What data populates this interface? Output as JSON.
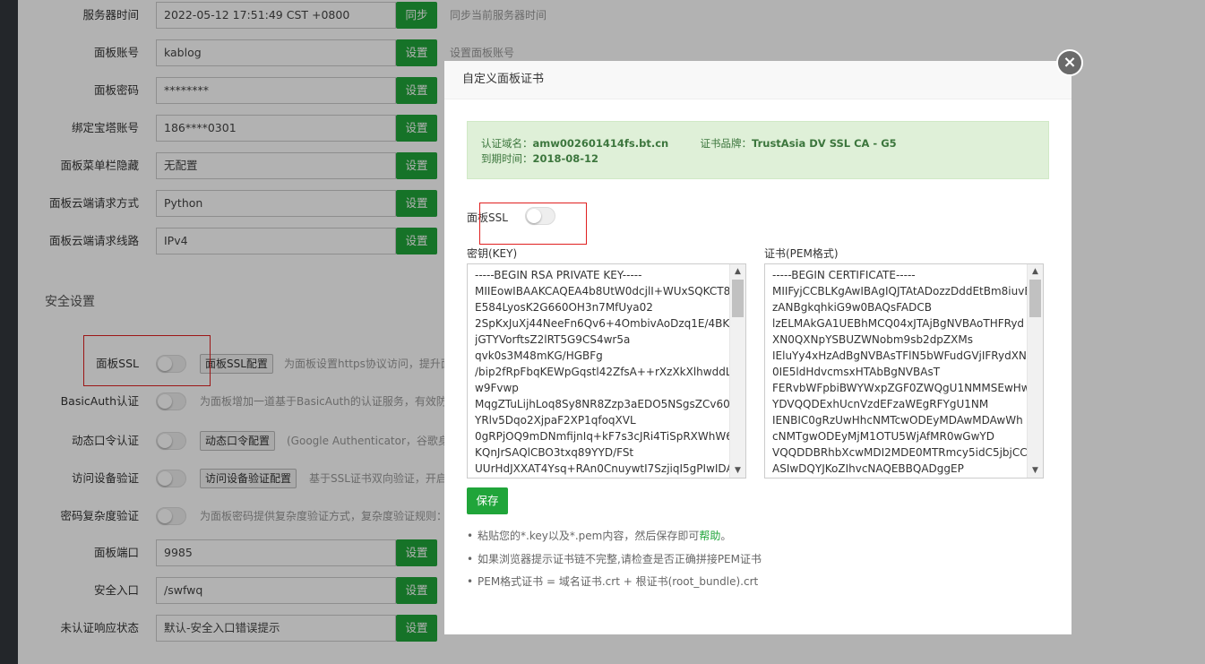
{
  "settings": {
    "rows": [
      {
        "label": "服务器时间",
        "value": "2022-05-12 17:51:49 CST +0800",
        "button": "同步",
        "hint": "同步当前服务器时间"
      },
      {
        "label": "面板账号",
        "value": "kablog",
        "button": "设置",
        "hint": "设置面板账号"
      },
      {
        "label": "面板密码",
        "value": "********",
        "button": "设置",
        "hint": ""
      },
      {
        "label": "绑定宝塔账号",
        "value": "186****0301",
        "button": "设置",
        "hint": ""
      },
      {
        "label": "面板菜单栏隐藏",
        "value": "无配置",
        "button": "设置",
        "hint": ""
      },
      {
        "label": "面板云端请求方式",
        "value": "Python",
        "button": "设置",
        "hint": ""
      },
      {
        "label": "面板云端请求线路",
        "value": "IPv4",
        "button": "设置",
        "hint": ""
      }
    ],
    "security_title": "安全设置",
    "toggles": [
      {
        "label": "面板SSL",
        "button": "面板SSL配置",
        "desc": "为面板设置https协议访问，提升面"
      },
      {
        "label": "BasicAuth认证",
        "button": "",
        "desc": "为面板增加一道基于BasicAuth的认证服务，有效防"
      },
      {
        "label": "动态口令认证",
        "button": "动态口令配置",
        "desc": "(Google Authenticator，谷歌身"
      },
      {
        "label": "访问设备验证",
        "button": "访问设备验证配置",
        "desc": "基于SSL证书双向验证，开启"
      },
      {
        "label": "密码复杂度验证",
        "button": "",
        "desc": "为面板密码提供复杂度验证方式，复杂度验证规则："
      }
    ],
    "rows2": [
      {
        "label": "面板端口",
        "value": "9985",
        "button": "设置"
      },
      {
        "label": "安全入口",
        "value": "/swfwq",
        "button": "设置"
      },
      {
        "label": "未认证响应状态",
        "value": "默认-安全入口错误提示",
        "button": "设置"
      }
    ]
  },
  "modal": {
    "title": "自定义面板证书",
    "close": "×",
    "domain_label": "认证域名：",
    "domain": "amw002601414fs.bt.cn",
    "brand_label": "证书品牌：",
    "brand": "TrustAsia DV SSL CA - G5",
    "expire_label": "到期时间：",
    "expire": "2018-08-12",
    "ssl_label": "面板SSL",
    "key_label": "密钥(KEY)",
    "cert_label": "证书(PEM格式)",
    "key_lines": [
      "-----BEGIN RSA PRIVATE KEY-----",
      "MIIEowIBAAKCAQEA4b8UtW0dcjlI+WUxSQKCT8",
      "E584LyosK2G660OH3n7MfUya02",
      "2SpKxJuXj44NeeFn6Qv6+4OmbivAoDzq1E/4BKE",
      "jGTYVorftsZ2lRT5G9CS4wr5a",
      "qvk0s3M48mKG/HGBFg",
      "/bip2fRpFbqKEWpGqstl42ZfsA++rXzXkXlhwddL",
      "w9Fvwp",
      "MqgZTuLijhLoq8Sy8NR8Zzp3aEDO5NSgsZCv60Z",
      "YRlv5Dqo2XjpaF2XP1qfoqXVL",
      "0gRPjOQ9mDNmfijnIq+kF7s3cJRi4TiSpRXWhW6",
      "KQnJrSAQlCBO3txq89YYD/FSt",
      "UUrHdJXXAT4Ysq+RAn0CnuywtI7SzjiqI5gPIwIDA"
    ],
    "cert_lines": [
      "-----BEGIN CERTIFICATE-----",
      "MIIFyjCCBLKgAwIBAgIQJTAtADozzDddEtBm8iuvE",
      "zANBgkqhkiG9w0BAQsFADCB",
      "lzELMAkGA1UEBhMCQ04xJTAjBgNVBAoTHFRyd",
      "XN0QXNpYSBUZWNobm9sb2dpZXMs",
      "IEluYy4xHzAdBgNVBAsTFlN5bWFudGVjIFRydXN",
      "0IE5ldHdvcmsxHTAbBgNVBAsT",
      "FERvbWFpbiBWYWxpZGF0ZWQgU1NMMSEwHw",
      "YDVQQDExhUcnVzdEFzaWEgRFYgU1NM",
      "IENBIC0gRzUwHhcNMTcwODEyMDAwMDAwWh",
      "cNMTgwODEyMjM1OTU5WjAfMR0wGwYD",
      "VQQDDBRhbXcwMDI2MDE0MTRmcy5idC5jbjCC",
      "ASIwDQYJKoZIhvcNAQEBBQADggEP"
    ],
    "save": "保存",
    "tip1_pre": "粘贴您的*.key以及*.pem内容，然后保存即可",
    "tip1_link": "帮助",
    "tip1_post": "。",
    "tip2": "如果浏览器提示证书链不完整,请检查是否正确拼接PEM证书",
    "tip3": "PEM格式证书 = 域名证书.crt + 根证书(root_bundle).crt"
  }
}
